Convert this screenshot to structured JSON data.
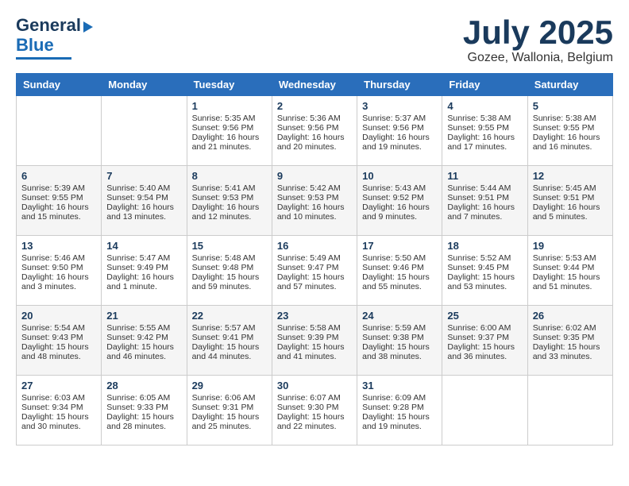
{
  "header": {
    "logo_line1": "General",
    "logo_line2": "Blue",
    "month": "July 2025",
    "location": "Gozee, Wallonia, Belgium"
  },
  "weekdays": [
    "Sunday",
    "Monday",
    "Tuesday",
    "Wednesday",
    "Thursday",
    "Friday",
    "Saturday"
  ],
  "weeks": [
    [
      {
        "day": "",
        "sunrise": "",
        "sunset": "",
        "daylight": ""
      },
      {
        "day": "",
        "sunrise": "",
        "sunset": "",
        "daylight": ""
      },
      {
        "day": "1",
        "sunrise": "Sunrise: 5:35 AM",
        "sunset": "Sunset: 9:56 PM",
        "daylight": "Daylight: 16 hours and 21 minutes."
      },
      {
        "day": "2",
        "sunrise": "Sunrise: 5:36 AM",
        "sunset": "Sunset: 9:56 PM",
        "daylight": "Daylight: 16 hours and 20 minutes."
      },
      {
        "day": "3",
        "sunrise": "Sunrise: 5:37 AM",
        "sunset": "Sunset: 9:56 PM",
        "daylight": "Daylight: 16 hours and 19 minutes."
      },
      {
        "day": "4",
        "sunrise": "Sunrise: 5:38 AM",
        "sunset": "Sunset: 9:55 PM",
        "daylight": "Daylight: 16 hours and 17 minutes."
      },
      {
        "day": "5",
        "sunrise": "Sunrise: 5:38 AM",
        "sunset": "Sunset: 9:55 PM",
        "daylight": "Daylight: 16 hours and 16 minutes."
      }
    ],
    [
      {
        "day": "6",
        "sunrise": "Sunrise: 5:39 AM",
        "sunset": "Sunset: 9:55 PM",
        "daylight": "Daylight: 16 hours and 15 minutes."
      },
      {
        "day": "7",
        "sunrise": "Sunrise: 5:40 AM",
        "sunset": "Sunset: 9:54 PM",
        "daylight": "Daylight: 16 hours and 13 minutes."
      },
      {
        "day": "8",
        "sunrise": "Sunrise: 5:41 AM",
        "sunset": "Sunset: 9:53 PM",
        "daylight": "Daylight: 16 hours and 12 minutes."
      },
      {
        "day": "9",
        "sunrise": "Sunrise: 5:42 AM",
        "sunset": "Sunset: 9:53 PM",
        "daylight": "Daylight: 16 hours and 10 minutes."
      },
      {
        "day": "10",
        "sunrise": "Sunrise: 5:43 AM",
        "sunset": "Sunset: 9:52 PM",
        "daylight": "Daylight: 16 hours and 9 minutes."
      },
      {
        "day": "11",
        "sunrise": "Sunrise: 5:44 AM",
        "sunset": "Sunset: 9:51 PM",
        "daylight": "Daylight: 16 hours and 7 minutes."
      },
      {
        "day": "12",
        "sunrise": "Sunrise: 5:45 AM",
        "sunset": "Sunset: 9:51 PM",
        "daylight": "Daylight: 16 hours and 5 minutes."
      }
    ],
    [
      {
        "day": "13",
        "sunrise": "Sunrise: 5:46 AM",
        "sunset": "Sunset: 9:50 PM",
        "daylight": "Daylight: 16 hours and 3 minutes."
      },
      {
        "day": "14",
        "sunrise": "Sunrise: 5:47 AM",
        "sunset": "Sunset: 9:49 PM",
        "daylight": "Daylight: 16 hours and 1 minute."
      },
      {
        "day": "15",
        "sunrise": "Sunrise: 5:48 AM",
        "sunset": "Sunset: 9:48 PM",
        "daylight": "Daylight: 15 hours and 59 minutes."
      },
      {
        "day": "16",
        "sunrise": "Sunrise: 5:49 AM",
        "sunset": "Sunset: 9:47 PM",
        "daylight": "Daylight: 15 hours and 57 minutes."
      },
      {
        "day": "17",
        "sunrise": "Sunrise: 5:50 AM",
        "sunset": "Sunset: 9:46 PM",
        "daylight": "Daylight: 15 hours and 55 minutes."
      },
      {
        "day": "18",
        "sunrise": "Sunrise: 5:52 AM",
        "sunset": "Sunset: 9:45 PM",
        "daylight": "Daylight: 15 hours and 53 minutes."
      },
      {
        "day": "19",
        "sunrise": "Sunrise: 5:53 AM",
        "sunset": "Sunset: 9:44 PM",
        "daylight": "Daylight: 15 hours and 51 minutes."
      }
    ],
    [
      {
        "day": "20",
        "sunrise": "Sunrise: 5:54 AM",
        "sunset": "Sunset: 9:43 PM",
        "daylight": "Daylight: 15 hours and 48 minutes."
      },
      {
        "day": "21",
        "sunrise": "Sunrise: 5:55 AM",
        "sunset": "Sunset: 9:42 PM",
        "daylight": "Daylight: 15 hours and 46 minutes."
      },
      {
        "day": "22",
        "sunrise": "Sunrise: 5:57 AM",
        "sunset": "Sunset: 9:41 PM",
        "daylight": "Daylight: 15 hours and 44 minutes."
      },
      {
        "day": "23",
        "sunrise": "Sunrise: 5:58 AM",
        "sunset": "Sunset: 9:39 PM",
        "daylight": "Daylight: 15 hours and 41 minutes."
      },
      {
        "day": "24",
        "sunrise": "Sunrise: 5:59 AM",
        "sunset": "Sunset: 9:38 PM",
        "daylight": "Daylight: 15 hours and 38 minutes."
      },
      {
        "day": "25",
        "sunrise": "Sunrise: 6:00 AM",
        "sunset": "Sunset: 9:37 PM",
        "daylight": "Daylight: 15 hours and 36 minutes."
      },
      {
        "day": "26",
        "sunrise": "Sunrise: 6:02 AM",
        "sunset": "Sunset: 9:35 PM",
        "daylight": "Daylight: 15 hours and 33 minutes."
      }
    ],
    [
      {
        "day": "27",
        "sunrise": "Sunrise: 6:03 AM",
        "sunset": "Sunset: 9:34 PM",
        "daylight": "Daylight: 15 hours and 30 minutes."
      },
      {
        "day": "28",
        "sunrise": "Sunrise: 6:05 AM",
        "sunset": "Sunset: 9:33 PM",
        "daylight": "Daylight: 15 hours and 28 minutes."
      },
      {
        "day": "29",
        "sunrise": "Sunrise: 6:06 AM",
        "sunset": "Sunset: 9:31 PM",
        "daylight": "Daylight: 15 hours and 25 minutes."
      },
      {
        "day": "30",
        "sunrise": "Sunrise: 6:07 AM",
        "sunset": "Sunset: 9:30 PM",
        "daylight": "Daylight: 15 hours and 22 minutes."
      },
      {
        "day": "31",
        "sunrise": "Sunrise: 6:09 AM",
        "sunset": "Sunset: 9:28 PM",
        "daylight": "Daylight: 15 hours and 19 minutes."
      },
      {
        "day": "",
        "sunrise": "",
        "sunset": "",
        "daylight": ""
      },
      {
        "day": "",
        "sunrise": "",
        "sunset": "",
        "daylight": ""
      }
    ]
  ]
}
